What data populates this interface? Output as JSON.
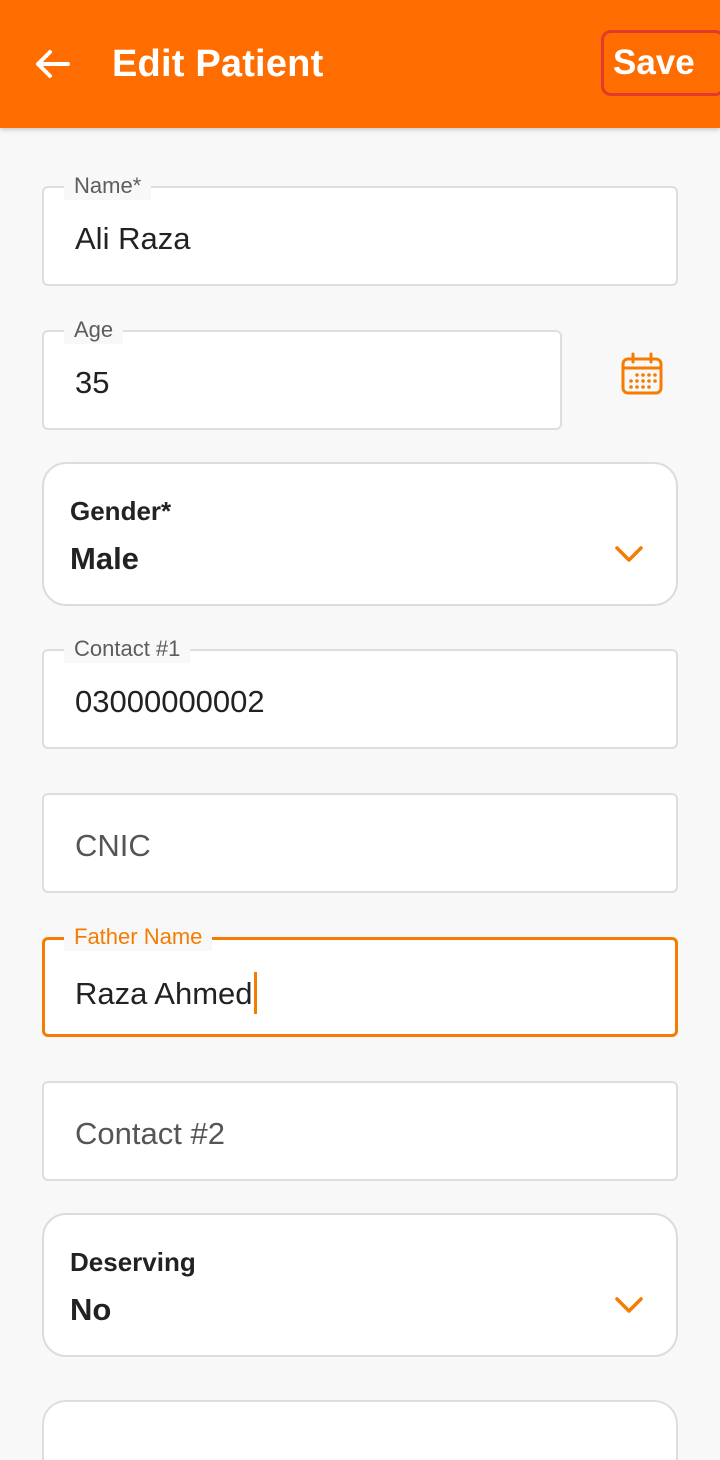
{
  "header": {
    "title": "Edit Patient",
    "save_label": "Save",
    "back_icon": "arrow-left-icon"
  },
  "form": {
    "name": {
      "label": "Name*",
      "value": "Ali Raza"
    },
    "age": {
      "label": "Age",
      "value": "35",
      "icon": "calendar-icon"
    },
    "gender": {
      "label": "Gender*",
      "value": "Male",
      "icon": "chevron-down-icon"
    },
    "contact1": {
      "label": "Contact #1",
      "value": "03000000002"
    },
    "cnic": {
      "placeholder": "CNIC"
    },
    "father_name": {
      "label": "Father Name",
      "value": "Raza Ahmed"
    },
    "contact2": {
      "placeholder": "Contact #2"
    },
    "deserving": {
      "label": "Deserving",
      "value": "No",
      "icon": "chevron-down-icon"
    }
  },
  "colors": {
    "primary": "#ff6d00",
    "accent": "#f57c00",
    "save_border": "#e23b2e",
    "background": "#f8f8f8",
    "field_border": "#dedede"
  }
}
